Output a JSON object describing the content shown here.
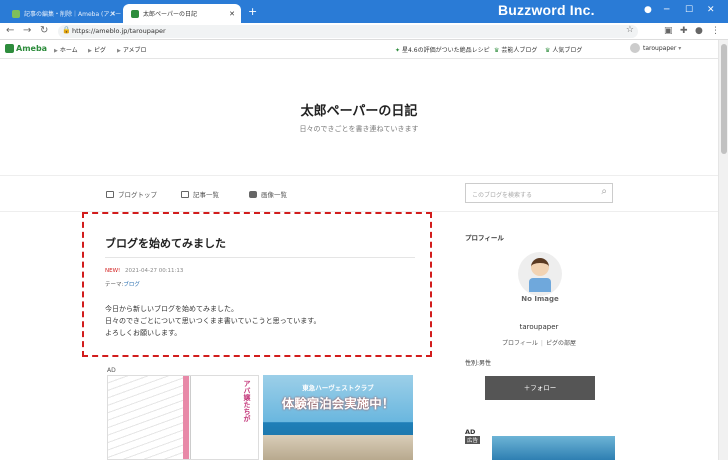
{
  "browser": {
    "tabs": [
      {
        "label": "記事の編集・削除｜Ameba (アメー",
        "favicon_color": "#7fbf5a"
      },
      {
        "label": "太郎ペーパーの日記",
        "favicon_color": "#2d8c3c"
      }
    ],
    "brand": "Buzzword Inc.",
    "url": "https://ameblo.jp/taroupaper"
  },
  "ameba_nav": {
    "logo": "Ameba",
    "links": [
      "ホーム",
      "ピグ",
      "アメブロ"
    ],
    "right_links": [
      "星4.6の評価がついた絶品レシピ",
      "芸能人ブログ",
      "人気ブログ"
    ],
    "user": "taroupaper"
  },
  "blog": {
    "title": "太郎ペーパーの日記",
    "description": "日々のできごとを書き連ねていきます"
  },
  "subnav": {
    "items": [
      "ブログトップ",
      "記事一覧",
      "画像一覧"
    ],
    "search_placeholder": "このブログを検索する"
  },
  "article": {
    "title": "ブログを始めてみました",
    "new_label": "NEW!",
    "date": "2021-04-27 00:11:13",
    "theme_prefix": "テーマ:",
    "theme": "ブログ",
    "body": [
      "今日から新しいブログを始めてみました。",
      "日々のできごとについて思いつくまま書いていこうと思っています。",
      "よろしくお願いします。"
    ]
  },
  "ads": {
    "label": "AD",
    "ad1_text": "アバ嬢たちが",
    "ad2_line1": "東急ハーヴェストクラブ",
    "ad2_line2": "体験宿泊会実施中！"
  },
  "sidebar": {
    "profile_heading": "プロフィール",
    "no_image": "No Image",
    "name": "taroupaper",
    "links": [
      "プロフィール",
      "ピグの部屋"
    ],
    "gender": "性別:男性",
    "follow": "＋フォロー",
    "ad_heading": "AD",
    "ad_tag": "広告"
  }
}
